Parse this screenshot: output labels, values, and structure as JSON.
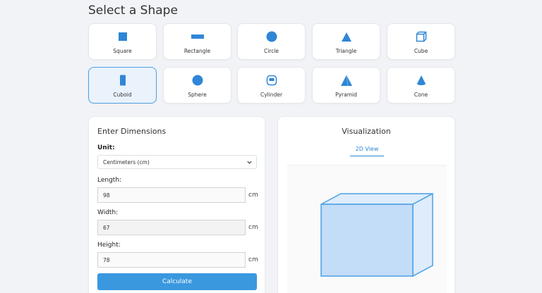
{
  "page": {
    "title": "Select a Shape"
  },
  "shapes": [
    {
      "label": "Square",
      "icon": "square-icon"
    },
    {
      "label": "Rectangle",
      "icon": "rectangle-icon"
    },
    {
      "label": "Circle",
      "icon": "circle-icon"
    },
    {
      "label": "Triangle",
      "icon": "triangle-icon"
    },
    {
      "label": "Cube",
      "icon": "cube-icon"
    },
    {
      "label": "Cuboid",
      "icon": "cuboid-icon",
      "selected": true
    },
    {
      "label": "Sphere",
      "icon": "sphere-icon"
    },
    {
      "label": "Cylinder",
      "icon": "cylinder-icon"
    },
    {
      "label": "Pyramid",
      "icon": "pyramid-icon"
    },
    {
      "label": "Cone",
      "icon": "cone-icon"
    }
  ],
  "dimensions": {
    "title": "Enter Dimensions",
    "unit_label": "Unit:",
    "unit_selected": "Centimeters (cm)",
    "length": {
      "label": "Length:",
      "value": "98",
      "unit": "cm"
    },
    "width": {
      "label": "Width:",
      "value": "67",
      "unit": "cm"
    },
    "height": {
      "label": "Height:",
      "value": "78",
      "unit": "cm"
    },
    "calculate_label": "Calculate"
  },
  "visualization": {
    "title": "Visualization",
    "tab_label": "2D View"
  },
  "colors": {
    "accent": "#2f86d6",
    "button": "#3a98df",
    "shape_fill_front": "#c3dcf7",
    "shape_fill_side": "#deecfb",
    "shape_stroke": "#4aa0e6"
  }
}
